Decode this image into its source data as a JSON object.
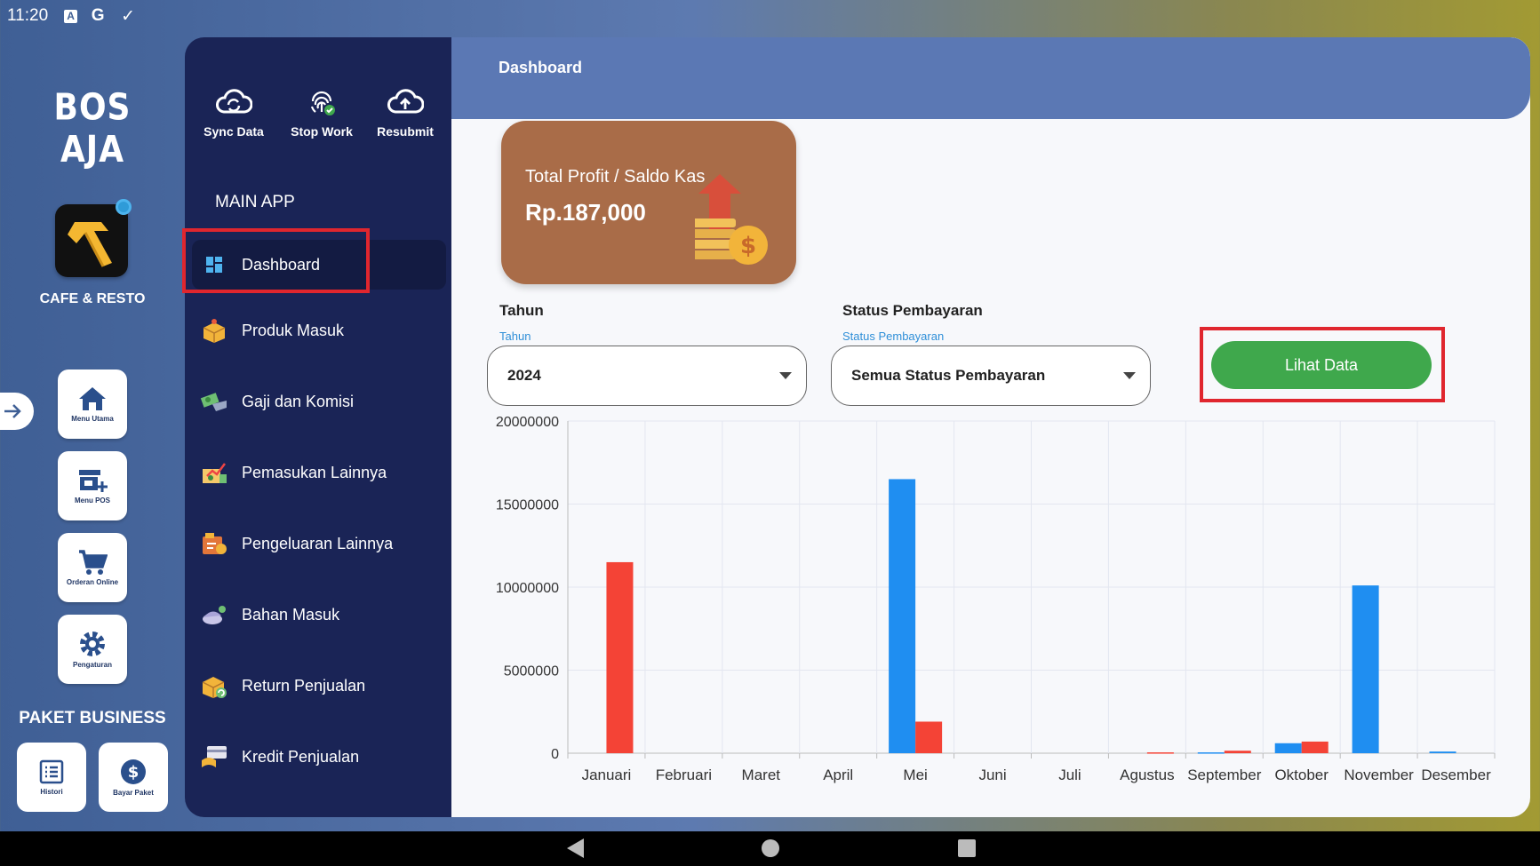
{
  "statusbar": {
    "time": "11:20",
    "icons": [
      "a-icon",
      "google-icon",
      "check-icon"
    ],
    "a_glyph": "A",
    "g_glyph": "G",
    "check_glyph": "✓"
  },
  "rail": {
    "logo": "BOS AJA",
    "brand_label": "CAFE & RESTO",
    "buttons": [
      {
        "label": "Menu Utama",
        "icon": "home-icon"
      },
      {
        "label": "Menu POS",
        "icon": "store-add-icon"
      },
      {
        "label": "Orderan Online",
        "icon": "cart-icon"
      },
      {
        "label": "Pengaturan",
        "icon": "gear-icon"
      }
    ],
    "paket_title": "PAKET BUSINESS",
    "paket_buttons": [
      {
        "label": "Histori",
        "icon": "list-icon"
      },
      {
        "label": "Bayar Paket",
        "icon": "dollar-icon"
      }
    ]
  },
  "sidebar": {
    "actions": [
      {
        "label": "Sync Data",
        "icon": "cloud-sync-icon"
      },
      {
        "label": "Stop Work",
        "icon": "fingerprint-icon"
      },
      {
        "label": "Resubmit",
        "icon": "cloud-upload-icon"
      }
    ],
    "section_title": "MAIN APP",
    "items": [
      {
        "label": "Dashboard",
        "icon": "dashboard-icon"
      },
      {
        "label": "Produk Masuk",
        "icon": "box-icon"
      },
      {
        "label": "Gaji dan Komisi",
        "icon": "money-icon"
      },
      {
        "label": "Pemasukan Lainnya",
        "icon": "income-icon"
      },
      {
        "label": "Pengeluaran Lainnya",
        "icon": "expense-icon"
      },
      {
        "label": "Bahan Masuk",
        "icon": "ingredient-icon"
      },
      {
        "label": "Return Penjualan",
        "icon": "return-icon"
      },
      {
        "label": "Kredit Penjualan",
        "icon": "credit-icon"
      }
    ]
  },
  "main": {
    "title": "Dashboard",
    "profit_card": {
      "title": "Total Profit / Saldo Kas",
      "value": "Rp.187,000"
    },
    "tahun": {
      "label": "Tahun",
      "float_label": "Tahun",
      "value": "2024"
    },
    "status": {
      "label": "Status Pembayaran",
      "float_label": "Status Pembayaran",
      "value": "Semua Status Pembayaran"
    },
    "button_label": "Lihat Data"
  },
  "colors": {
    "blue_series": "#1f8ef1",
    "red_series": "#f44336",
    "sidebar": "#1a2456",
    "accent_green": "#3fa84c"
  },
  "chart_data": {
    "type": "bar",
    "categories": [
      "Januari",
      "Februari",
      "Maret",
      "April",
      "Mei",
      "Juni",
      "Juli",
      "Agustus",
      "September",
      "Oktober",
      "November",
      "Desember"
    ],
    "series": [
      {
        "color": "#1f8ef1",
        "values": [
          0,
          0,
          0,
          0,
          16500000,
          0,
          0,
          0,
          50000,
          600000,
          10100000,
          100000
        ]
      },
      {
        "color": "#f44336",
        "values": [
          11500000,
          0,
          0,
          0,
          1900000,
          0,
          0,
          50000,
          150000,
          700000,
          0,
          0
        ]
      }
    ],
    "yticks": [
      "0",
      "5000000",
      "10000000",
      "15000000",
      "20000000"
    ],
    "ylim": [
      0,
      20000000
    ],
    "grid": true
  }
}
